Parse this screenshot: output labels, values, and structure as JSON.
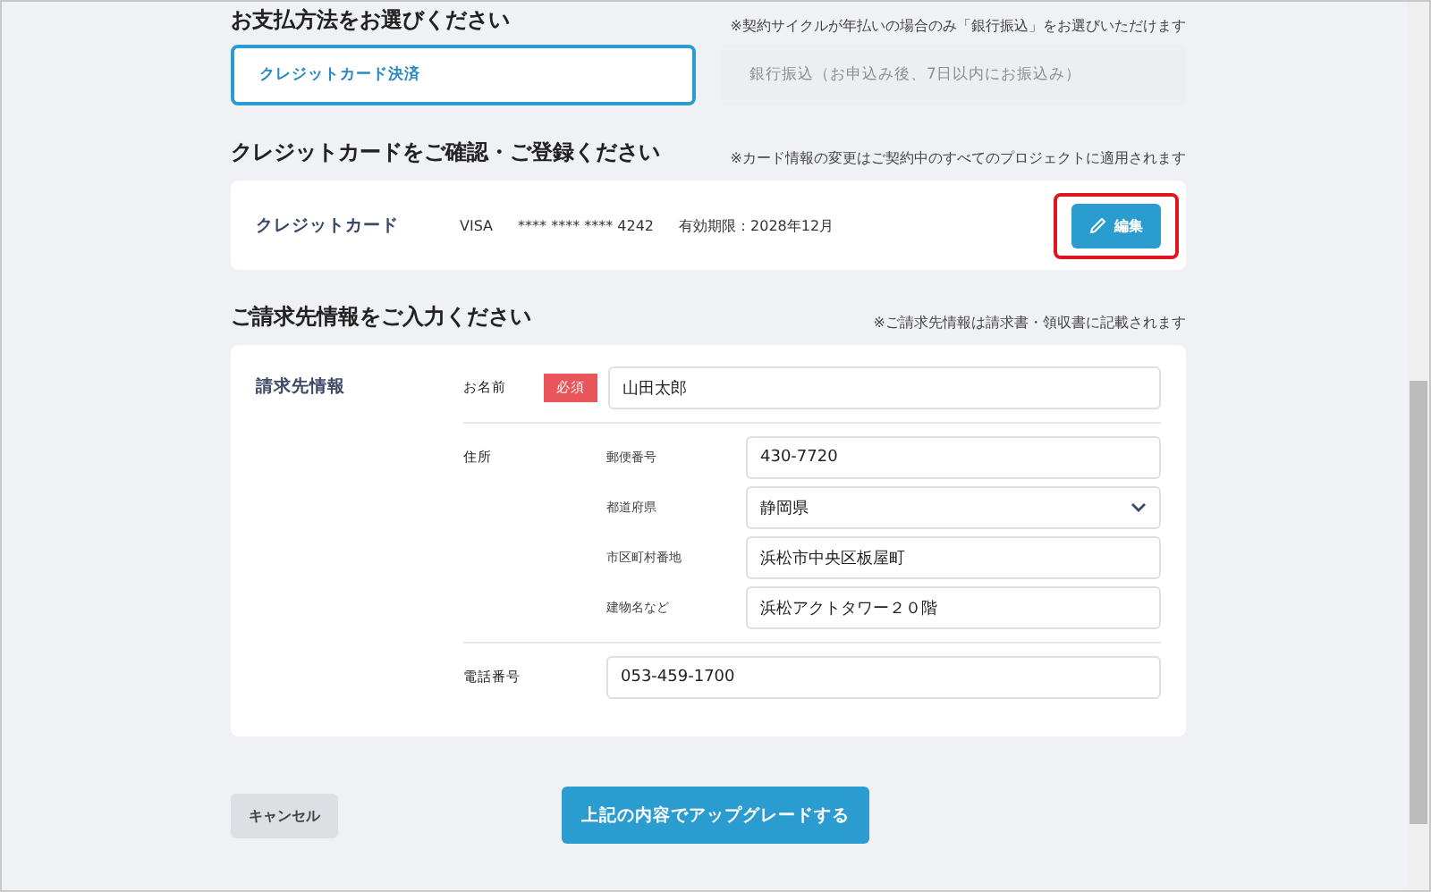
{
  "payment_section": {
    "title": "お支払方法をお選びください",
    "note": "※契約サイクルが年払いの場合のみ「銀行振込」をお選びいただけます",
    "options": [
      {
        "label": "クレジットカード決済",
        "selected": true
      },
      {
        "label": "銀行振込（お申込み後、7日以内にお振込み）",
        "selected": false
      }
    ]
  },
  "card_section": {
    "title": "クレジットカードをご確認・ご登録ください",
    "note": "※カード情報の変更はご契約中のすべてのプロジェクトに適用されます",
    "label": "クレジットカード",
    "brand": "VISA",
    "number": "**** **** **** 4242",
    "expiry": "有効期限：2028年12月",
    "edit_button": "編集",
    "highlighted": true
  },
  "billing_section": {
    "title": "ご請求先情報をご入力ください",
    "note": "※ご請求先情報は請求書・領収書に記載されます",
    "label": "請求先情報",
    "name": {
      "label": "お名前",
      "required_badge": "必須",
      "value": "山田太郎"
    },
    "address": {
      "label": "住所",
      "fields": [
        {
          "kind": "text",
          "label": "郵便番号",
          "value": "430-7720"
        },
        {
          "kind": "select",
          "label": "都道府県",
          "value": "静岡県"
        },
        {
          "kind": "text",
          "label": "市区町村番地",
          "value": "浜松市中央区板屋町"
        },
        {
          "kind": "text",
          "label": "建物名など",
          "value": "浜松アクトタワー２０階"
        }
      ]
    },
    "phone": {
      "label": "電話番号",
      "value": "053-459-1700"
    }
  },
  "buttons": {
    "cancel": "キャンセル",
    "submit": "上記の内容でアップグレードする"
  }
}
